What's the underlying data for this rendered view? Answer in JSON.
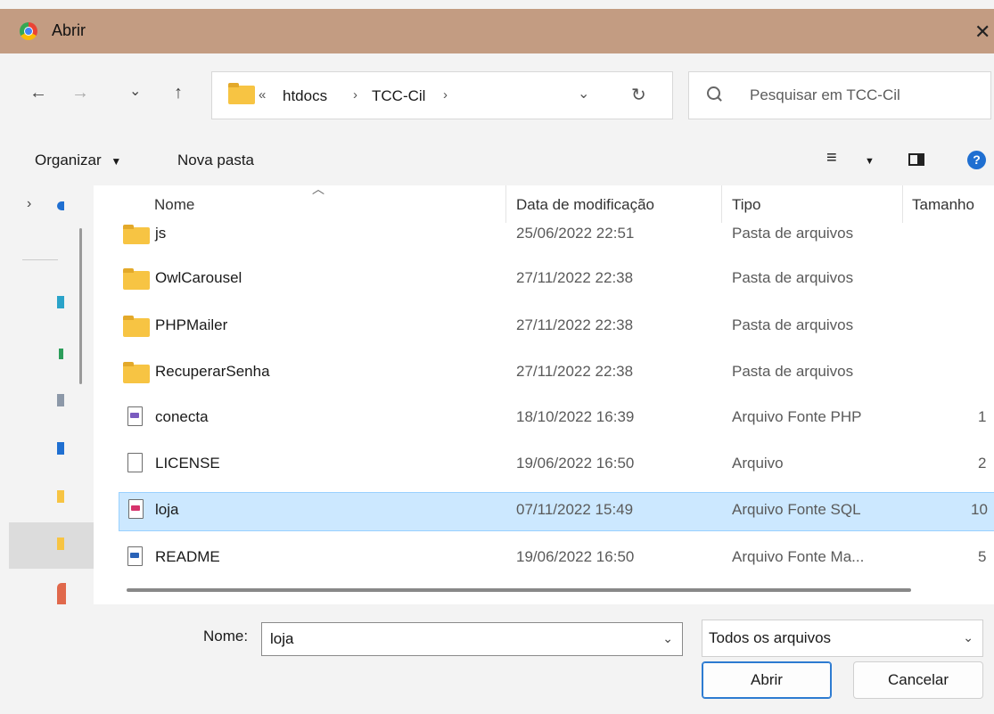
{
  "window": {
    "title": "Abrir",
    "close_glyph": "✕",
    "icon": "chrome-icon"
  },
  "nav": {
    "back": "←",
    "forward": "→",
    "recent": "⌄",
    "up": "↑",
    "address": {
      "overflow": "«",
      "crumbs": [
        "htdocs",
        "TCC-Cil"
      ],
      "separator": "›",
      "dropdown": "⌄",
      "refresh": "↻"
    },
    "search_placeholder": "Pesquisar em TCC-Cil"
  },
  "toolbar": {
    "organize_label": "Organizar",
    "new_folder_label": "Nova pasta",
    "view_glyph": "≡",
    "help_glyph": "?"
  },
  "columns": {
    "name": "Nome",
    "modified": "Data de modificação",
    "type": "Tipo",
    "size": "Tamanho"
  },
  "files": [
    {
      "name": "js",
      "date": "25/06/2022 22:51",
      "type": "Pasta de arquivos",
      "size": "",
      "kind": "folder"
    },
    {
      "name": "OwlCarousel",
      "date": "27/11/2022 22:38",
      "type": "Pasta de arquivos",
      "size": "",
      "kind": "folder"
    },
    {
      "name": "PHPMailer",
      "date": "27/11/2022 22:38",
      "type": "Pasta de arquivos",
      "size": "",
      "kind": "folder"
    },
    {
      "name": "RecuperarSenha",
      "date": "27/11/2022 22:38",
      "type": "Pasta de arquivos",
      "size": "",
      "kind": "folder"
    },
    {
      "name": "conecta",
      "date": "18/10/2022 16:39",
      "type": "Arquivo Fonte PHP",
      "size": "1",
      "kind": "php"
    },
    {
      "name": "LICENSE",
      "date": "19/06/2022 16:50",
      "type": "Arquivo",
      "size": "2",
      "kind": "file"
    },
    {
      "name": "loja",
      "date": "07/11/2022 15:49",
      "type": "Arquivo Fonte SQL",
      "size": "10",
      "kind": "sql",
      "selected": true
    },
    {
      "name": "README",
      "date": "19/06/2022 16:50",
      "type": "Arquivo Fonte Ma...",
      "size": "5",
      "kind": "md"
    }
  ],
  "footer": {
    "name_label": "Nome:",
    "name_value": "loja",
    "filter_value": "Todos os arquivos",
    "open_label": "Abrir",
    "cancel_label": "Cancelar"
  },
  "colors": {
    "titlebar": "#c39c82",
    "selection": "#cce8ff",
    "folder": "#f7c443",
    "accent": "#2d7bd1"
  }
}
